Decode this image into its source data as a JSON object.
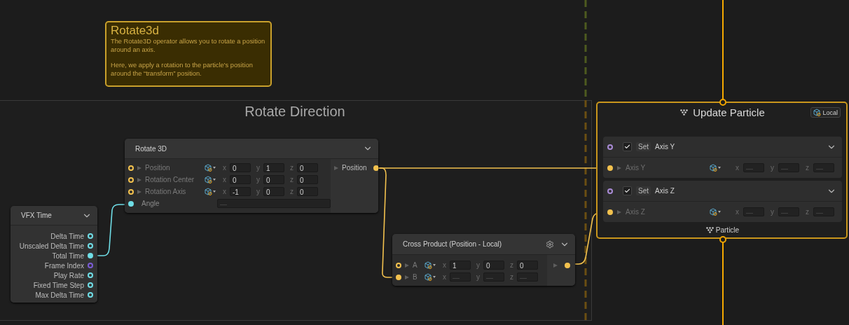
{
  "sticky_note": {
    "title": "Rotate3d",
    "paragraphs": [
      "The Rotate3D operator allows you to rotate a position around an axis.",
      "Here, we apply a rotation to the particle's position around the “transform” position."
    ]
  },
  "group": {
    "title": "Rotate Direction"
  },
  "rotate_3d": {
    "title": "Rotate 3D",
    "inputs": [
      {
        "label": "Position",
        "connected": false,
        "fields": [
          {
            "axis": "x",
            "value": "0"
          },
          {
            "axis": "y",
            "value": "1"
          },
          {
            "axis": "z",
            "value": "0"
          }
        ]
      },
      {
        "label": "Rotation Center",
        "connected": false,
        "fields": [
          {
            "axis": "x",
            "value": "0"
          },
          {
            "axis": "y",
            "value": "0"
          },
          {
            "axis": "z",
            "value": "0"
          }
        ]
      },
      {
        "label": "Rotation Axis",
        "connected": false,
        "fields": [
          {
            "axis": "x",
            "value": "-1"
          },
          {
            "axis": "y",
            "value": "0"
          },
          {
            "axis": "z",
            "value": "0"
          }
        ]
      }
    ],
    "angle": {
      "label": "Angle",
      "connected": true,
      "placeholder": "—"
    },
    "output": {
      "label": "Position",
      "connected": true
    }
  },
  "vfx_time": {
    "title": "VFX Time",
    "outputs": [
      {
        "label": "Delta Time",
        "connected": false,
        "color": "#6fdde6"
      },
      {
        "label": "Unscaled Delta Time",
        "connected": false,
        "color": "#6fdde6"
      },
      {
        "label": "Total Time",
        "connected": true,
        "color": "#6fdde6"
      },
      {
        "label": "Frame Index",
        "connected": false,
        "color": "#7b5cd6"
      },
      {
        "label": "Play Rate",
        "connected": false,
        "color": "#6fdde6"
      },
      {
        "label": "Fixed Time Step",
        "connected": false,
        "color": "#6fdde6"
      },
      {
        "label": "Max Delta Time",
        "connected": false,
        "color": "#6fdde6"
      }
    ]
  },
  "cross_product": {
    "title": "Cross Product (Position - Local)",
    "inputs": [
      {
        "label": "A",
        "connected": false,
        "fields": [
          {
            "axis": "x",
            "value": "1"
          },
          {
            "axis": "y",
            "value": "0"
          },
          {
            "axis": "z",
            "value": "0"
          }
        ]
      },
      {
        "label": "B",
        "connected": true,
        "fields": [
          {
            "axis": "x",
            "placeholder": "—"
          },
          {
            "axis": "y",
            "placeholder": "—"
          },
          {
            "axis": "z",
            "placeholder": "—"
          }
        ]
      }
    ],
    "output": {
      "connected": true
    }
  },
  "update_particle": {
    "title": "Update Particle",
    "space": "Local",
    "footer": "Particle",
    "blocks": [
      {
        "checked": true,
        "verb": "Set",
        "attribute": "Axis Y",
        "input": {
          "label": "Axis Y",
          "connected": true,
          "fields": [
            {
              "axis": "x",
              "placeholder": "—"
            },
            {
              "axis": "y",
              "placeholder": "—"
            },
            {
              "axis": "z",
              "placeholder": "—"
            }
          ]
        }
      },
      {
        "checked": true,
        "verb": "Set",
        "attribute": "Axis Z",
        "input": {
          "label": "Axis Z",
          "connected": true,
          "fields": [
            {
              "axis": "x",
              "placeholder": "—"
            },
            {
              "axis": "y",
              "placeholder": "—"
            },
            {
              "axis": "z",
              "placeholder": "—"
            }
          ]
        }
      }
    ]
  }
}
